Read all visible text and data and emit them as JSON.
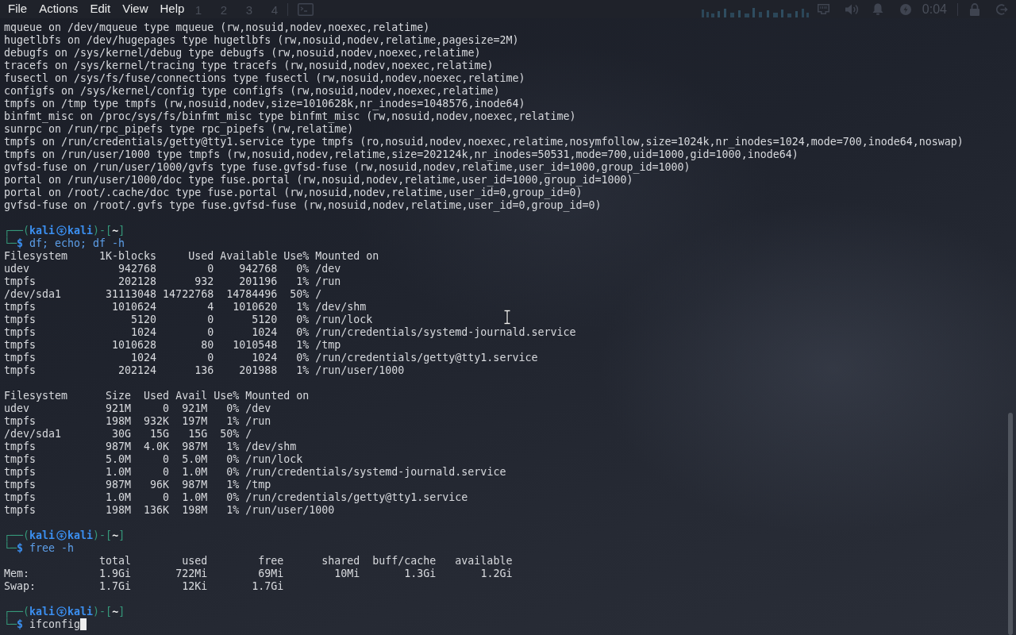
{
  "menu_bar": {
    "items": [
      "File",
      "Actions",
      "Edit",
      "View",
      "Help"
    ]
  },
  "panel": {
    "workspaces": [
      "1",
      "2",
      "3",
      "4"
    ],
    "clock": "0:04"
  },
  "terminal": {
    "blocks": [
      {
        "kind": "lines",
        "lines": [
          "mqueue on /dev/mqueue type mqueue (rw,nosuid,nodev,noexec,relatime)",
          "hugetlbfs on /dev/hugepages type hugetlbfs (rw,nosuid,nodev,relatime,pagesize=2M)",
          "debugfs on /sys/kernel/debug type debugfs (rw,nosuid,nodev,noexec,relatime)",
          "tracefs on /sys/kernel/tracing type tracefs (rw,nosuid,nodev,noexec,relatime)",
          "fusectl on /sys/fs/fuse/connections type fusectl (rw,nosuid,nodev,noexec,relatime)",
          "configfs on /sys/kernel/config type configfs (rw,nosuid,nodev,noexec,relatime)",
          "tmpfs on /tmp type tmpfs (rw,nosuid,nodev,size=1010628k,nr_inodes=1048576,inode64)",
          "binfmt_misc on /proc/sys/fs/binfmt_misc type binfmt_misc (rw,nosuid,nodev,noexec,relatime)",
          "sunrpc on /run/rpc_pipefs type rpc_pipefs (rw,relatime)",
          "tmpfs on /run/credentials/getty@tty1.service type tmpfs (ro,nosuid,nodev,noexec,relatime,nosymfollow,size=1024k,nr_inodes=1024,mode=700,inode64,noswap)",
          "tmpfs on /run/user/1000 type tmpfs (rw,nosuid,nodev,relatime,size=202124k,nr_inodes=50531,mode=700,uid=1000,gid=1000,inode64)",
          "gvfsd-fuse on /run/user/1000/gvfs type fuse.gvfsd-fuse (rw,nosuid,nodev,relatime,user_id=1000,group_id=1000)",
          "portal on /run/user/1000/doc type fuse.portal (rw,nosuid,nodev,relatime,user_id=1000,group_id=1000)",
          "portal on /root/.cache/doc type fuse.portal (rw,nosuid,nodev,relatime,user_id=0,group_id=0)",
          "gvfsd-fuse on /root/.gvfs type fuse.gvfsd-fuse (rw,nosuid,nodev,relatime,user_id=0,group_id=0)"
        ]
      },
      {
        "kind": "prompt",
        "open": "┌──(",
        "user": "kali",
        "host": "kali",
        "middle": ")-[",
        "cwd": "~",
        "close": "]",
        "corner": "└─",
        "sign": "$",
        "command": "df; echo; df -h",
        "highlighted": true,
        "cursor": false
      },
      {
        "kind": "table",
        "columns": [
          "Filesystem",
          "1K-blocks",
          "Used",
          "Available",
          "Use%",
          "Mounted on"
        ],
        "rows": [
          {
            "cells": [
              "udev",
              "942768",
              "0",
              "942768",
              "0%",
              "/dev"
            ]
          },
          {
            "cells": [
              "tmpfs",
              "202128",
              "932",
              "201196",
              "1%",
              "/run"
            ]
          },
          {
            "cells": [
              "/dev/sda1",
              "31113048",
              "14722768",
              "14784496",
              "50%",
              "/"
            ]
          },
          {
            "cells": [
              "tmpfs",
              "1010624",
              "4",
              "1010620",
              "1%",
              "/dev/shm"
            ]
          },
          {
            "cells": [
              "tmpfs",
              "5120",
              "0",
              "5120",
              "0%",
              "/run/lock"
            ]
          },
          {
            "cells": [
              "tmpfs",
              "1024",
              "0",
              "1024",
              "0%",
              "/run/credentials/systemd-journald.service"
            ]
          },
          {
            "cells": [
              "tmpfs",
              "1010628",
              "80",
              "1010548",
              "1%",
              "/tmp"
            ]
          },
          {
            "cells": [
              "tmpfs",
              "1024",
              "0",
              "1024",
              "0%",
              "/run/credentials/getty@tty1.service"
            ]
          },
          {
            "cells": [
              "tmpfs",
              "202124",
              "136",
              "201988",
              "1%",
              "/run/user/1000"
            ]
          }
        ]
      },
      {
        "kind": "table",
        "columns": [
          "Filesystem",
          "Size",
          "Used",
          "Avail",
          "Use%",
          "Mounted on"
        ],
        "rows": [
          {
            "cells": [
              "udev",
              "921M",
              "0",
              "921M",
              "0%",
              "/dev"
            ]
          },
          {
            "cells": [
              "tmpfs",
              "198M",
              "932K",
              "197M",
              "1%",
              "/run"
            ]
          },
          {
            "cells": [
              "/dev/sda1",
              "30G",
              "15G",
              "15G",
              "50%",
              "/"
            ]
          },
          {
            "cells": [
              "tmpfs",
              "987M",
              "4.0K",
              "987M",
              "1%",
              "/dev/shm"
            ]
          },
          {
            "cells": [
              "tmpfs",
              "5.0M",
              "0",
              "5.0M",
              "0%",
              "/run/lock"
            ]
          },
          {
            "cells": [
              "tmpfs",
              "1.0M",
              "0",
              "1.0M",
              "0%",
              "/run/credentials/systemd-journald.service"
            ]
          },
          {
            "cells": [
              "tmpfs",
              "987M",
              "96K",
              "987M",
              "1%",
              "/tmp"
            ]
          },
          {
            "cells": [
              "tmpfs",
              "1.0M",
              "0",
              "1.0M",
              "0%",
              "/run/credentials/getty@tty1.service"
            ]
          },
          {
            "cells": [
              "tmpfs",
              "198M",
              "136K",
              "198M",
              "1%",
              "/run/user/1000"
            ]
          }
        ]
      },
      {
        "kind": "prompt",
        "open": "┌──(",
        "user": "kali",
        "host": "kali",
        "middle": ")-[",
        "cwd": "~",
        "close": "]",
        "corner": "└─",
        "sign": "$",
        "command": "free -h",
        "highlighted": true,
        "cursor": false
      },
      {
        "kind": "table",
        "columns": [
          "total",
          "used",
          "free",
          "shared",
          "buff/cache",
          "available"
        ],
        "rows": [
          {
            "label": "Mem:",
            "cells": [
              "1.9Gi",
              "722Mi",
              "69Mi",
              "10Mi",
              "1.3Gi",
              "1.2Gi"
            ]
          },
          {
            "label": "Swap:",
            "cells": [
              "1.7Gi",
              "12Ki",
              "1.7Gi"
            ]
          }
        ]
      },
      {
        "kind": "prompt",
        "open": "┌──(",
        "user": "kali",
        "host": "kali",
        "middle": ")-[",
        "cwd": "~",
        "close": "]",
        "corner": "└─",
        "sign": "$",
        "command": "ifconfig",
        "highlighted": false,
        "cursor": true
      }
    ]
  }
}
